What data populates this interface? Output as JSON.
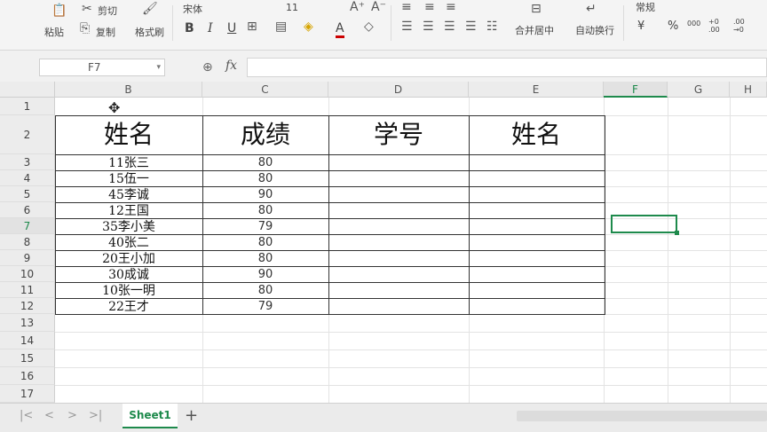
{
  "ribbon": {
    "paste": "粘贴",
    "cut": "剪切",
    "copy": "复制",
    "format_painter": "格式刷",
    "font_name": "宋体",
    "font_size": "11",
    "bold": "B",
    "italic": "I",
    "underline": "U",
    "font_color": "A",
    "merge_center": "合并居中",
    "wrap_text": "自动换行",
    "number_format": "常规",
    "currency": "¥",
    "percent": "%",
    "thousands": "000",
    "inc_decimal": "+0 .00",
    "dec_decimal": ".00 →0"
  },
  "formula_bar": {
    "name_box": "F7",
    "fx": "fx",
    "value": ""
  },
  "columns": [
    "B",
    "C",
    "D",
    "E",
    "F",
    "G",
    "H"
  ],
  "rows": [
    "1",
    "2",
    "3",
    "4",
    "5",
    "6",
    "7",
    "8",
    "9",
    "10",
    "11",
    "12",
    "13",
    "14",
    "15",
    "16",
    "17"
  ],
  "table": {
    "headers": [
      "姓名",
      "成绩",
      "学号",
      "姓名"
    ],
    "rows": [
      [
        "11张三",
        "80",
        "",
        ""
      ],
      [
        "15伍一",
        "80",
        "",
        ""
      ],
      [
        "45李诚",
        "90",
        "",
        ""
      ],
      [
        "12王国",
        "80",
        "",
        ""
      ],
      [
        "35李小美",
        "79",
        "",
        ""
      ],
      [
        "40张二",
        "80",
        "",
        ""
      ],
      [
        "20王小加",
        "80",
        "",
        ""
      ],
      [
        "30成诚",
        "90",
        "",
        ""
      ],
      [
        "10张一明",
        "80",
        "",
        ""
      ],
      [
        "22王才",
        "79",
        "",
        ""
      ]
    ]
  },
  "tabs": {
    "sheet1": "Sheet1",
    "add": "+"
  },
  "colors": {
    "accent": "#1e8a4c",
    "border": "#333333"
  }
}
